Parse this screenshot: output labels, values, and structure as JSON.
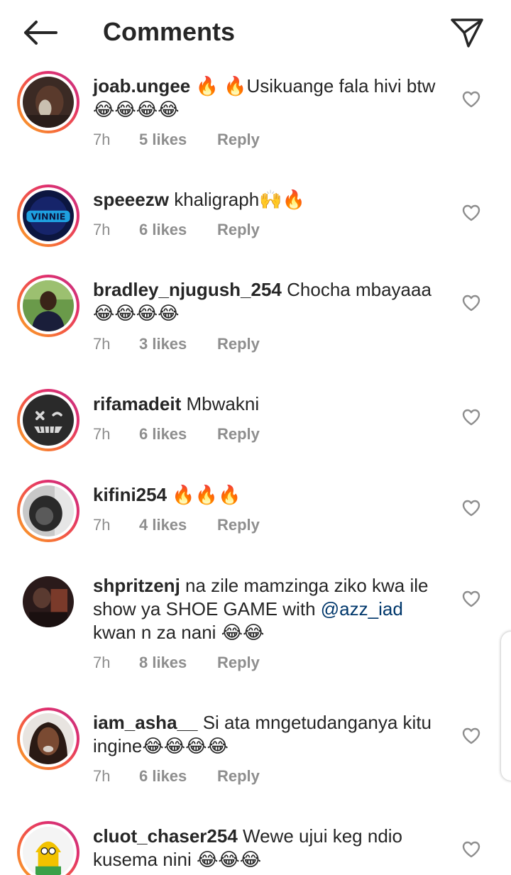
{
  "header": {
    "title": "Comments",
    "back_icon": "arrow-left-icon",
    "share_icon": "paper-plane-icon"
  },
  "comments": [
    {
      "username": "joab.ungee",
      "text": "🔥 🔥Usikuange fala hivi btw😂😂😂😂",
      "time": "7h",
      "likes": "5 likes",
      "reply": "Reply",
      "avatar": "avatar-photo-child"
    },
    {
      "username": "speeezw",
      "text": "khaligraph🙌🔥",
      "time": "7h",
      "likes": "6 likes",
      "reply": "Reply",
      "avatar": "avatar-vinnie-logo"
    },
    {
      "username": "bradley_njugush_254",
      "text": "Chocha mbayaaa 😂😂😂😂",
      "time": "7h",
      "likes": "3 likes",
      "reply": "Reply",
      "avatar": "avatar-photo-man"
    },
    {
      "username": "rifamadeit",
      "text": "Mbwakni",
      "time": "7h",
      "likes": "6 likes",
      "reply": "Reply",
      "avatar": "avatar-dark-smiley"
    },
    {
      "username": "kifini254",
      "text": "🔥🔥🔥",
      "time": "7h",
      "likes": "4 likes",
      "reply": "Reply",
      "avatar": "avatar-photo-grey"
    },
    {
      "username": "shpritzenj",
      "text_before": "na zile mamzinga ziko kwa ile show ya  SHOE  GAME  with ",
      "mention": "@azz_iad",
      "text_after": "  kwan n za nani 😂😂",
      "time": "7h",
      "likes": "8 likes",
      "reply": "Reply",
      "avatar": "avatar-photo-dark"
    },
    {
      "username": "iam_asha__",
      "text": "Si ata mngetudanganya kitu ingine😂😂😂😂",
      "time": "7h",
      "likes": "6 likes",
      "reply": "Reply",
      "avatar": "avatar-photo-woman"
    },
    {
      "username": "cluot_chaser254",
      "text": "Wewe ujui keg ndio kusema nini 😂😂😂",
      "avatar": "avatar-cartoon"
    }
  ],
  "icons": {
    "like": "heart-outline-icon"
  }
}
